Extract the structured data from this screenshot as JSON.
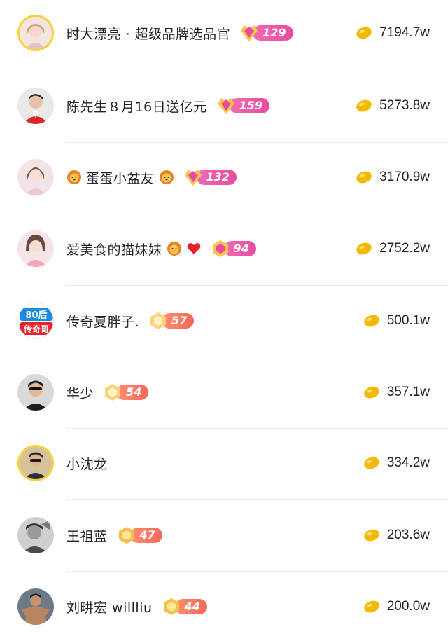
{
  "rows": [
    {
      "name": "时大漂亮 · 超级品牌选品官",
      "level": "129",
      "amount": "7194.7w",
      "badge": "pink"
    },
    {
      "name": "陈先生８月16日送亿元",
      "level": "159",
      "amount": "5273.8w",
      "badge": "pink"
    },
    {
      "name": "蛋蛋小盆友",
      "level": "132",
      "amount": "3170.9w",
      "badge": "pink"
    },
    {
      "name": "爱美食的猫妹妹",
      "level": "94",
      "amount": "2752.2w",
      "badge": "pink"
    },
    {
      "name": "传奇夏胖子.",
      "level": "57",
      "amount": "500.1w",
      "badge": "orange",
      "avatar_text_top": "80后",
      "avatar_text_bottom": "传奇哥"
    },
    {
      "name": "华少",
      "level": "54",
      "amount": "357.1w",
      "badge": "orange"
    },
    {
      "name": "小沈龙",
      "amount": "334.2w"
    },
    {
      "name": "王祖蓝",
      "level": "47",
      "amount": "203.6w",
      "badge": "orange"
    },
    {
      "name": "刘畊宏 willliu",
      "level": "44",
      "amount": "200.0w",
      "badge": "orange"
    }
  ],
  "icons": {
    "coin": "gold-bean-icon",
    "lion": "lion-emoji-icon",
    "heart": "red-heart-emoji-icon",
    "gem": "level-gem-icon"
  },
  "colors": {
    "pink_badge": "#e84c9e",
    "orange_badge": "#f4685a",
    "coin": "#f5b800",
    "divider": "#ececec"
  }
}
